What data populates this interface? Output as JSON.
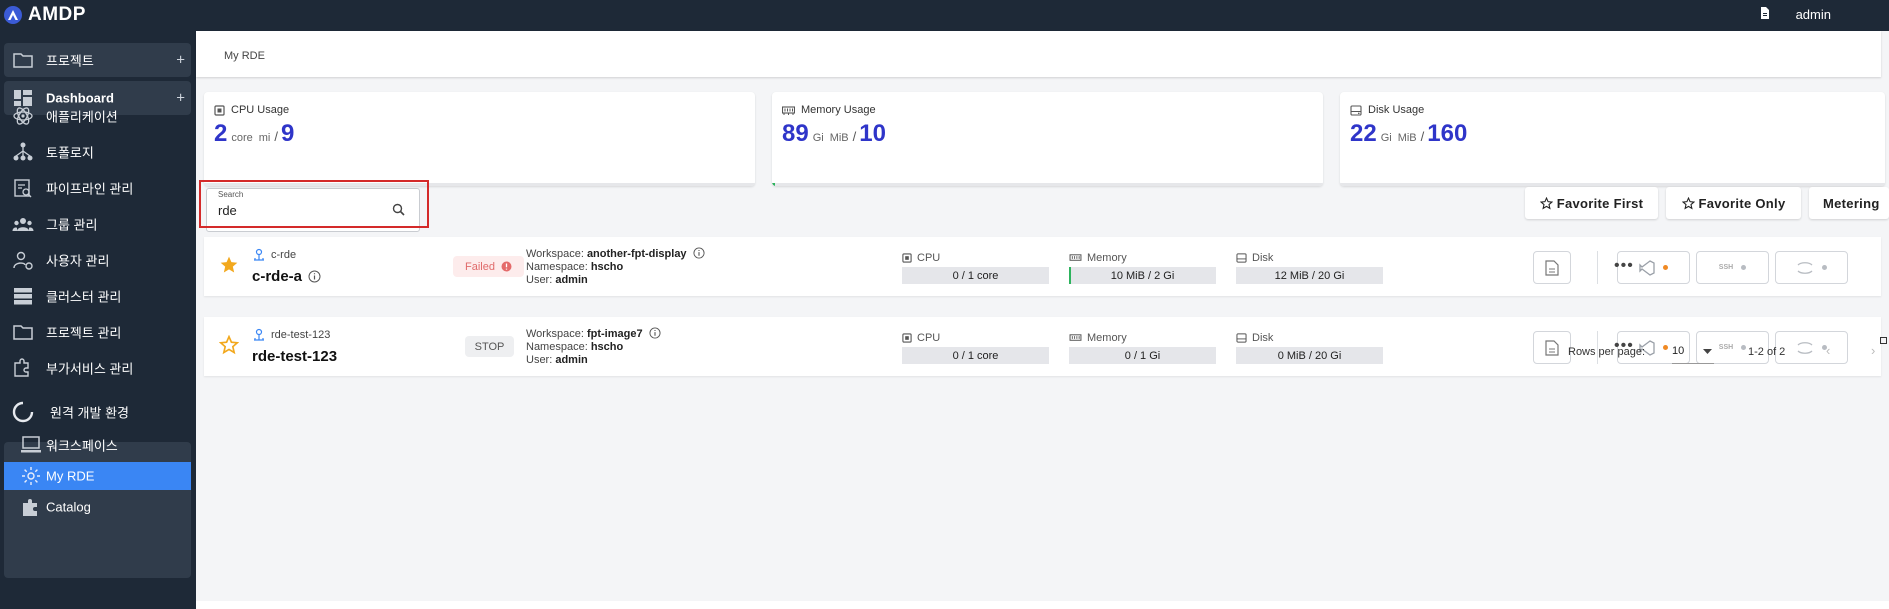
{
  "app": {
    "name": "AMDP",
    "user": "admin",
    "doc_icon": "document-icon"
  },
  "sidebar": {
    "items": [
      {
        "label": "프로젝트",
        "icon": "folder-icon",
        "expandable": true
      },
      {
        "label": "Dashboard",
        "icon": "dashboard-icon",
        "expandable": true
      },
      {
        "label": "애플리케이션",
        "icon": "atom-icon"
      },
      {
        "label": "토폴로지",
        "icon": "topology-icon"
      },
      {
        "label": "파이프라인 관리",
        "icon": "pipeline-icon"
      },
      {
        "label": "그룹 관리",
        "icon": "group-icon"
      },
      {
        "label": "사용자 관리",
        "icon": "user-gear-icon"
      },
      {
        "label": "클러스터 관리",
        "icon": "cluster-icon"
      },
      {
        "label": "프로젝트 관리",
        "icon": "folder-icon"
      },
      {
        "label": "부가서비스 관리",
        "icon": "puzzle-gear-icon"
      }
    ],
    "rde_group": {
      "label": "원격 개발 환경",
      "children": [
        {
          "label": "워크스페이스",
          "icon": "monitor-icon"
        },
        {
          "label": "My RDE",
          "icon": "gear-icon",
          "active": true
        },
        {
          "label": "Catalog",
          "icon": "puzzle-icon"
        }
      ]
    },
    "plus": "+"
  },
  "breadcrumb": "My RDE",
  "usage": {
    "cpu": {
      "title": "CPU Usage",
      "used": "2",
      "unit1": "core",
      "unit2": "mi",
      "slash": "/",
      "total": "9",
      "fill": 0.0
    },
    "memory": {
      "title": "Memory Usage",
      "used": "89",
      "unit1": "Gi",
      "unit2": "MiB",
      "slash": "/",
      "total": "10",
      "fill": 0.005
    },
    "disk": {
      "title": "Disk Usage",
      "used": "22",
      "unit1": "Gi",
      "unit2": "MiB",
      "slash": "/",
      "total": "160",
      "fill": 0.0
    }
  },
  "search": {
    "label": "Search",
    "value": "rde"
  },
  "filters": {
    "favorite_first": "Favorite First",
    "favorite_only": "Favorite Only",
    "metering": "Metering"
  },
  "rdes": [
    {
      "small_name": "c-rde",
      "name": "c-rde-a",
      "favorite": true,
      "status": "Failed",
      "workspace_label": "Workspace:",
      "workspace": "another-fpt-display",
      "namespace_label": "Namespace:",
      "namespace": "hscho",
      "user_label": "User:",
      "user": "admin",
      "cpu_label": "CPU",
      "cpu": "0 / 1 core",
      "memory_label": "Memory",
      "memory": "10 MiB / 2 Gi",
      "disk_label": "Disk",
      "disk": "12 MiB / 20 Gi",
      "ssh": "SSH"
    },
    {
      "small_name": "rde-test-123",
      "name": "rde-test-123",
      "favorite": false,
      "status": "STOP",
      "workspace_label": "Workspace:",
      "workspace": "fpt-image7",
      "namespace_label": "Namespace:",
      "namespace": "hscho",
      "user_label": "User:",
      "user": "admin",
      "cpu_label": "CPU",
      "cpu": "0 / 1 core",
      "memory_label": "Memory",
      "memory": "0 / 1 Gi",
      "disk_label": "Disk",
      "disk": "0 MiB / 20 Gi",
      "ssh": "SSH"
    }
  ],
  "pagination": {
    "rows_label": "Rows per page:",
    "rows_value": "10",
    "range": "1-2 of 2"
  },
  "colors": {
    "sidebar_bg": "#1e2937",
    "accent": "#3a86f4",
    "number": "#2f35c9",
    "failed": "#e06b6b",
    "favorite": "#f2a81d"
  }
}
